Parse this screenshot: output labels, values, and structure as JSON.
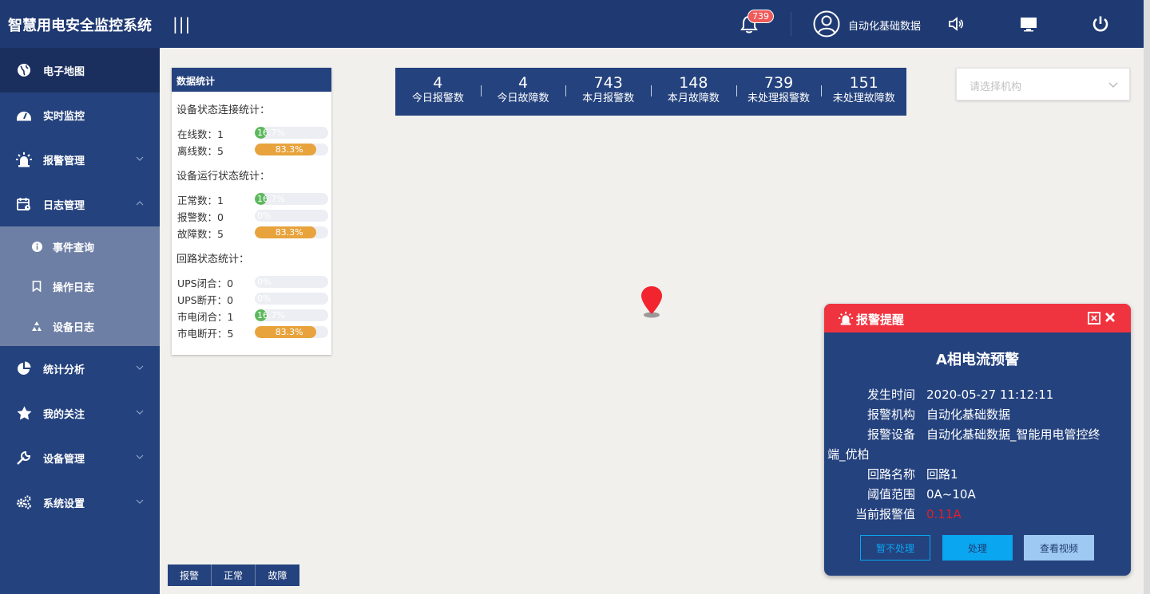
{
  "header": {
    "title": "智慧用电安全监控系统",
    "menu_toggle": "|||",
    "notification_count": "739",
    "user_name": "自动化基础数据"
  },
  "sidebar": {
    "items": [
      {
        "label": "电子地图",
        "icon": "globe-icon"
      },
      {
        "label": "实时监控",
        "icon": "dashboard-icon"
      },
      {
        "label": "报警管理",
        "icon": "alarm-light-icon"
      },
      {
        "label": "日志管理",
        "icon": "calendar-icon"
      },
      {
        "label": "统计分析",
        "icon": "pie-chart-icon"
      },
      {
        "label": "我的关注",
        "icon": "star-icon"
      },
      {
        "label": "设备管理",
        "icon": "wrench-icon"
      },
      {
        "label": "系统设置",
        "icon": "gears-icon"
      }
    ],
    "sub_items": [
      {
        "label": "事件查询",
        "icon": "info-icon"
      },
      {
        "label": "操作日志",
        "icon": "bookmark-icon"
      },
      {
        "label": "设备日志",
        "icon": "recycle-icon"
      }
    ]
  },
  "stats": {
    "title": "数据统计",
    "groups": [
      {
        "title": "设备状态连接统计：",
        "rows": [
          {
            "label": "在线数：1",
            "pct": 16.7,
            "text": "16.7%",
            "color": "#5cb85c"
          },
          {
            "label": "离线数：5",
            "pct": 83.3,
            "text": "83.3%",
            "color": "#e8a33d"
          }
        ]
      },
      {
        "title": "设备运行状态统计：",
        "rows": [
          {
            "label": "正常数：1",
            "pct": 16.7,
            "text": "16.7%",
            "color": "#5cb85c"
          },
          {
            "label": "报警数：0",
            "pct": 0,
            "text": "0%",
            "color": "#5cb85c"
          },
          {
            "label": "故障数：5",
            "pct": 83.3,
            "text": "83.3%",
            "color": "#e8a33d"
          }
        ]
      },
      {
        "title": "回路状态统计：",
        "rows": [
          {
            "label": "UPS闭合：0",
            "pct": 0,
            "text": "0%",
            "color": "#5cb85c"
          },
          {
            "label": "UPS断开：0",
            "pct": 0,
            "text": "0%",
            "color": "#5cb85c"
          },
          {
            "label": "市电闭合：1",
            "pct": 16.7,
            "text": "16.7%",
            "color": "#5cb85c"
          },
          {
            "label": "市电断开：5",
            "pct": 83.3,
            "text": "83.3%",
            "color": "#e8a33d"
          }
        ]
      }
    ]
  },
  "summary": [
    {
      "num": "4",
      "cap": "今日报警数"
    },
    {
      "num": "4",
      "cap": "今日故障数"
    },
    {
      "num": "743",
      "cap": "本月报警数"
    },
    {
      "num": "148",
      "cap": "本月故障数"
    },
    {
      "num": "739",
      "cap": "未处理报警数"
    },
    {
      "num": "151",
      "cap": "未处理故障数"
    }
  ],
  "org_select": {
    "placeholder": "请选择机构"
  },
  "legend": [
    "报警",
    "正常",
    "故障"
  ],
  "alarm": {
    "title": "报警提醒",
    "name": "A相电流预警",
    "fields": {
      "time_k": "发生时间",
      "time_v": "2020-05-27 11:12:11",
      "org_k": "报警机构",
      "org_v": "自动化基础数据",
      "dev_k": "报警设备",
      "dev_v": "自动化基础数据_智能用电管控终",
      "dev_v2": "端_优柏",
      "loop_k": "回路名称",
      "loop_v": "回路1",
      "range_k": "阈值范围",
      "range_v": "0A~10A",
      "cur_k": "当前报警值",
      "cur_v": "0.11A"
    },
    "buttons": {
      "ignore": "暂不处理",
      "handle": "处理",
      "video": "查看视频"
    }
  },
  "colors": {
    "header": "#1f3a72",
    "sidebar": "#24427e",
    "submenu": "#6e7fa5",
    "alarm_red": "#f0343f",
    "green": "#5cb85c",
    "orange": "#e8a33d",
    "handle_btn": "#0aa6f0",
    "video_btn": "#9ec9f2"
  }
}
